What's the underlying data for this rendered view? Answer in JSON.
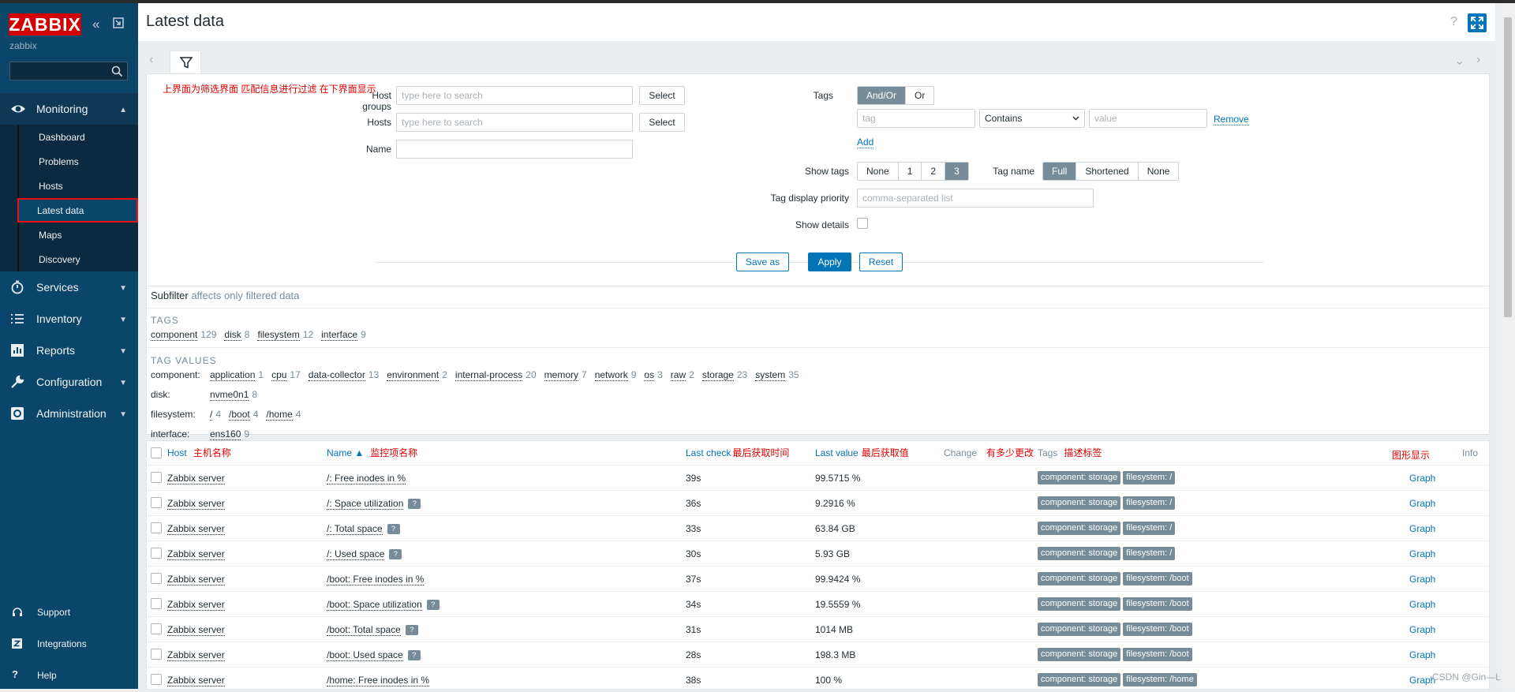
{
  "app": {
    "logo": "ZABBIX",
    "user": "zabbix"
  },
  "sidebar": {
    "menu": [
      {
        "label": "Monitoring",
        "icon": "eye-icon",
        "open": true
      },
      {
        "label": "Services",
        "icon": "services-icon"
      },
      {
        "label": "Inventory",
        "icon": "list-icon"
      },
      {
        "label": "Reports",
        "icon": "chart-icon"
      },
      {
        "label": "Configuration",
        "icon": "wrench-icon"
      },
      {
        "label": "Administration",
        "icon": "gear-icon"
      }
    ],
    "monitoring_sub": [
      "Dashboard",
      "Problems",
      "Hosts",
      "Latest data",
      "Maps",
      "Discovery"
    ],
    "bottom": [
      {
        "label": "Support",
        "icon": "headset-icon"
      },
      {
        "label": "Integrations",
        "icon": "z-icon"
      },
      {
        "label": "Help",
        "icon": "question-icon"
      }
    ]
  },
  "page": {
    "title": "Latest data",
    "help": "?"
  },
  "filter": {
    "annotation": "上界面为筛选界面 匹配信息进行过滤 在下界面显示",
    "host_groups_label": "Host groups",
    "host_groups_placeholder": "type here to search",
    "hosts_label": "Hosts",
    "hosts_placeholder": "type here to search",
    "name_label": "Name",
    "select_label": "Select",
    "tags_label": "Tags",
    "andor": "And/Or",
    "or": "Or",
    "tag_placeholder": "tag",
    "operator": "Contains",
    "value_placeholder": "value",
    "remove": "Remove",
    "add": "Add",
    "show_tags_label": "Show tags",
    "show_tags_options": [
      "None",
      "1",
      "2",
      "3"
    ],
    "tag_name_label": "Tag name",
    "tag_name_options": [
      "Full",
      "Shortened",
      "None"
    ],
    "tag_priority_label": "Tag display priority",
    "tag_priority_placeholder": "comma-separated list",
    "show_details_label": "Show details",
    "save_as": "Save as",
    "apply": "Apply",
    "reset": "Reset"
  },
  "subfilter": {
    "title": "Subfilter",
    "subtitle": "affects only filtered data",
    "tags_head": "TAGS",
    "tags": [
      {
        "name": "component",
        "count": "129"
      },
      {
        "name": "disk",
        "count": "8"
      },
      {
        "name": "filesystem",
        "count": "12"
      },
      {
        "name": "interface",
        "count": "9"
      }
    ],
    "values_head": "TAG VALUES",
    "values": [
      {
        "label": "component:",
        "items": [
          {
            "name": "application",
            "count": "1"
          },
          {
            "name": "cpu",
            "count": "17"
          },
          {
            "name": "data-collector",
            "count": "13"
          },
          {
            "name": "environment",
            "count": "2"
          },
          {
            "name": "internal-process",
            "count": "20"
          },
          {
            "name": "memory",
            "count": "7"
          },
          {
            "name": "network",
            "count": "9"
          },
          {
            "name": "os",
            "count": "3"
          },
          {
            "name": "raw",
            "count": "2"
          },
          {
            "name": "storage",
            "count": "23"
          },
          {
            "name": "system",
            "count": "35"
          }
        ]
      },
      {
        "label": "disk:",
        "items": [
          {
            "name": "nvme0n1",
            "count": "8"
          }
        ]
      },
      {
        "label": "filesystem:",
        "items": [
          {
            "name": "/",
            "count": "4"
          },
          {
            "name": "/boot",
            "count": "4"
          },
          {
            "name": "/home",
            "count": "4"
          }
        ]
      },
      {
        "label": "interface:",
        "items": [
          {
            "name": "ens160",
            "count": "9"
          }
        ]
      }
    ]
  },
  "table": {
    "headers": {
      "host": "Host",
      "host_cn": "主机名称",
      "name": "Name ▲",
      "name_cn": "监控项名称",
      "last_check": "Last check",
      "last_check_cn": "最后获取时间",
      "last_value": "Last value",
      "last_value_cn": "最后获取值",
      "change": "Change",
      "change_cn": "有多少更改",
      "tags": "Tags",
      "tags_cn": "描述标签",
      "graph_cn": "图形显示",
      "info": "Info"
    },
    "rows": [
      {
        "host": "Zabbix server",
        "name": "/: Free inodes in %",
        "help": false,
        "last_check": "39s",
        "last_value": "99.5715 %",
        "tags": [
          "component: storage",
          "filesystem: /"
        ],
        "graph": "Graph"
      },
      {
        "host": "Zabbix server",
        "name": "/: Space utilization",
        "help": true,
        "last_check": "36s",
        "last_value": "9.2916 %",
        "tags": [
          "component: storage",
          "filesystem: /"
        ],
        "graph": "Graph"
      },
      {
        "host": "Zabbix server",
        "name": "/: Total space",
        "help": true,
        "last_check": "33s",
        "last_value": "63.84 GB",
        "tags": [
          "component: storage",
          "filesystem: /"
        ],
        "graph": "Graph"
      },
      {
        "host": "Zabbix server",
        "name": "/: Used space",
        "help": true,
        "last_check": "30s",
        "last_value": "5.93 GB",
        "tags": [
          "component: storage",
          "filesystem: /"
        ],
        "graph": "Graph"
      },
      {
        "host": "Zabbix server",
        "name": "/boot: Free inodes in %",
        "help": false,
        "last_check": "37s",
        "last_value": "99.9424 %",
        "tags": [
          "component: storage",
          "filesystem: /boot"
        ],
        "graph": "Graph"
      },
      {
        "host": "Zabbix server",
        "name": "/boot: Space utilization",
        "help": true,
        "last_check": "34s",
        "last_value": "19.5559 %",
        "tags": [
          "component: storage",
          "filesystem: /boot"
        ],
        "graph": "Graph"
      },
      {
        "host": "Zabbix server",
        "name": "/boot: Total space",
        "help": true,
        "last_check": "31s",
        "last_value": "1014 MB",
        "tags": [
          "component: storage",
          "filesystem: /boot"
        ],
        "graph": "Graph"
      },
      {
        "host": "Zabbix server",
        "name": "/boot: Used space",
        "help": true,
        "last_check": "28s",
        "last_value": "198.3 MB",
        "tags": [
          "component: storage",
          "filesystem: /boot"
        ],
        "graph": "Graph"
      },
      {
        "host": "Zabbix server",
        "name": "/home: Free inodes in %",
        "help": false,
        "last_check": "38s",
        "last_value": "100 %",
        "tags": [
          "component: storage",
          "filesystem: /home"
        ],
        "graph": "Graph"
      }
    ]
  },
  "watermark": "CSDN @Gin—L"
}
